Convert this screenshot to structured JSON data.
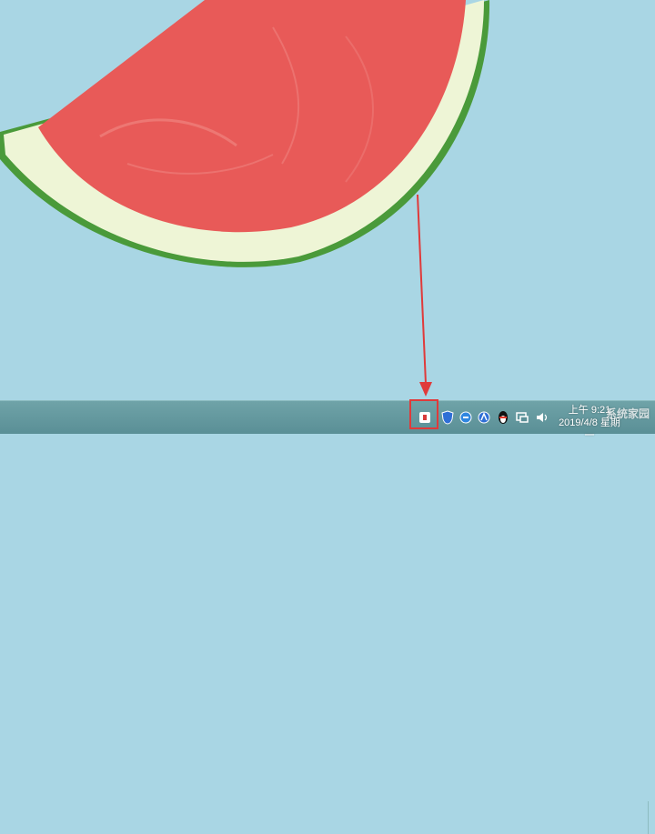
{
  "wallpaper": {
    "name": "watermelon-slice",
    "colors": {
      "background": "#a9d6e4",
      "flesh": "#e85a58",
      "rind_light": "#f0f6dc",
      "rind_dark": "#4a9a3a"
    }
  },
  "annotation": {
    "color": "#e03a3a"
  },
  "taskbar": {
    "tray_icons": [
      {
        "name": "security-app-icon",
        "color": "#d83b3b"
      },
      {
        "name": "shield-icon",
        "color": "#2f6fd6"
      },
      {
        "name": "browser-e-icon",
        "color": "#2f86e0"
      },
      {
        "name": "notification-a-icon",
        "color": "#2f6fd6"
      },
      {
        "name": "qq-penguin-icon",
        "color": "#111111"
      },
      {
        "name": "network-icon",
        "color": "#ffffff"
      },
      {
        "name": "volume-icon",
        "color": "#ffffff"
      }
    ],
    "clock": {
      "time": "上午 9:21",
      "date": "2019/4/8 星期一"
    }
  },
  "watermark": {
    "text": "系统家园"
  }
}
